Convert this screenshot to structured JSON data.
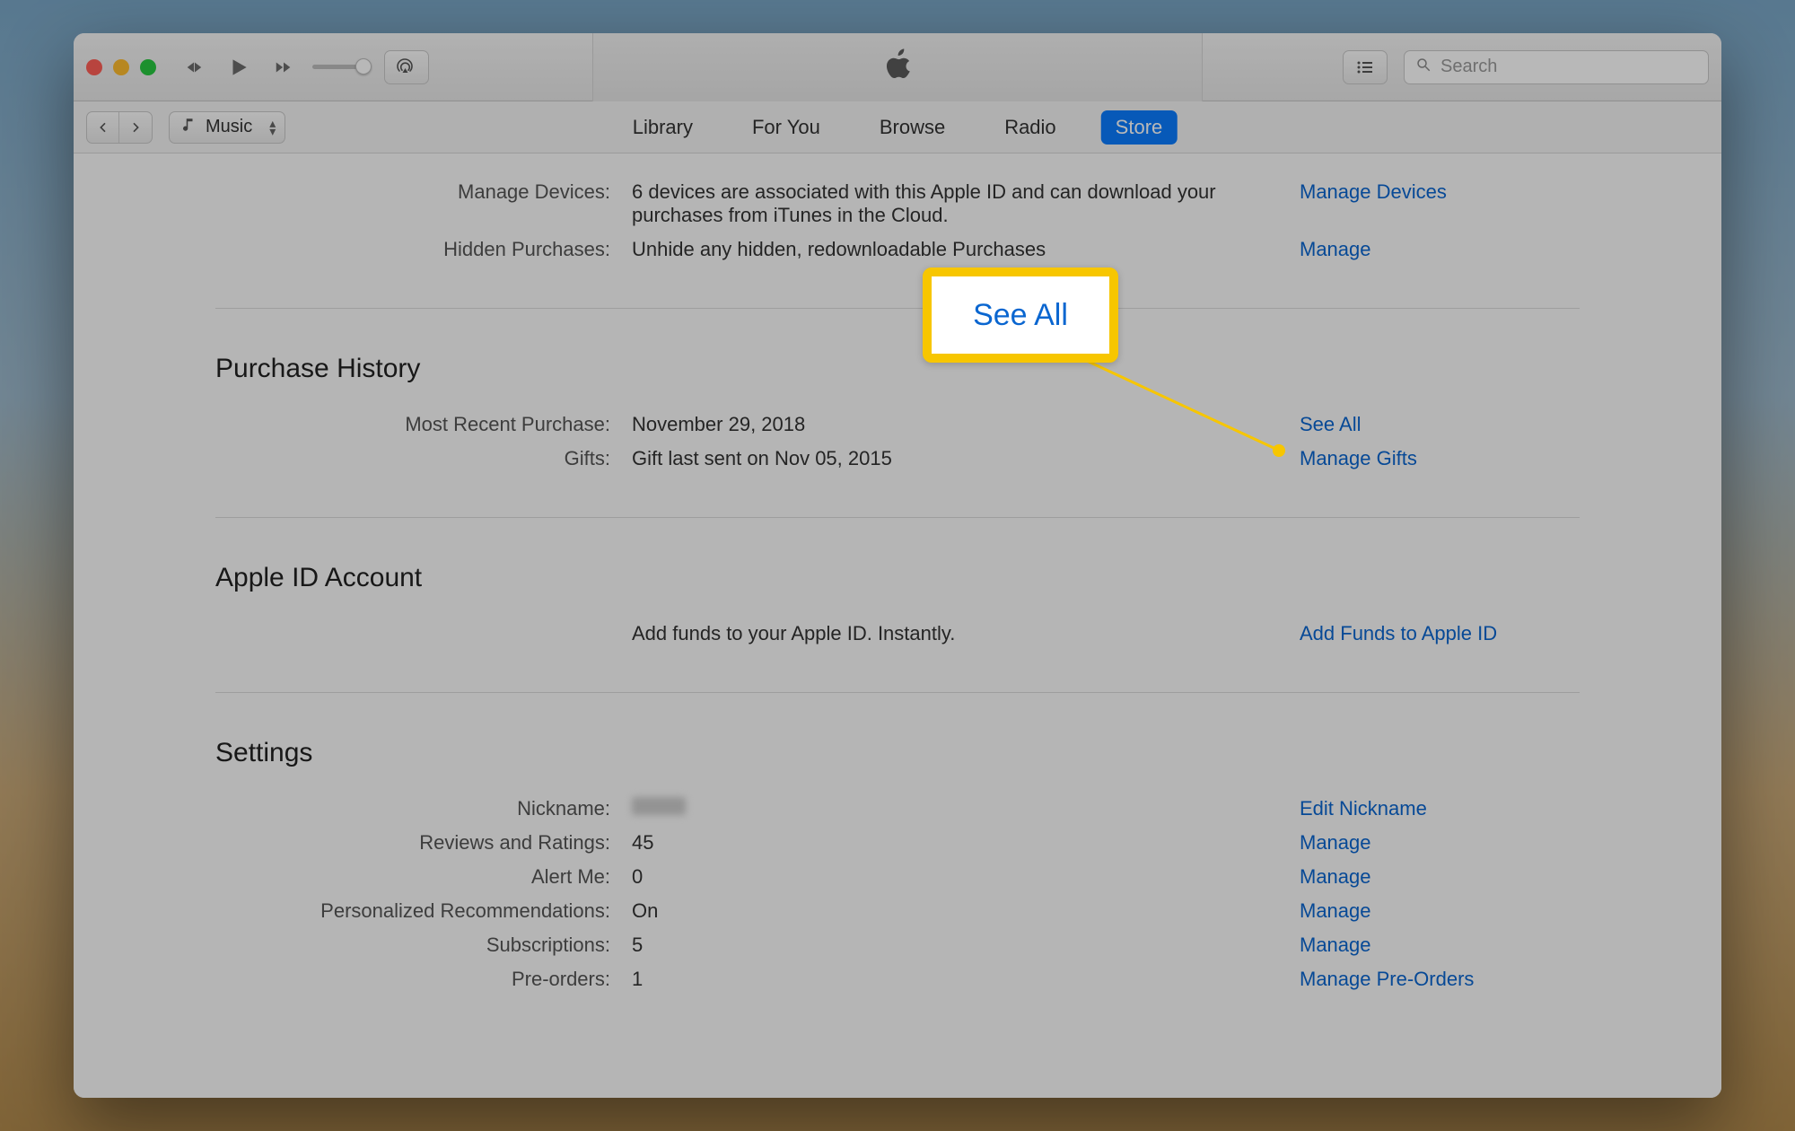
{
  "colors": {
    "accent": "#0a7cff",
    "link": "#0a66d0",
    "highlight": "#f7c600"
  },
  "titlebar": {
    "search_placeholder": "Search"
  },
  "nav": {
    "source_label": "Music",
    "tabs": {
      "library": "Library",
      "for_you": "For You",
      "browse": "Browse",
      "radio": "Radio",
      "store": "Store"
    },
    "active_tab": "store"
  },
  "callout": {
    "label": "See All"
  },
  "sections": {
    "cloud": {
      "rows": {
        "manage_devices": {
          "label": "Manage Devices:",
          "value": "6 devices are associated with this Apple ID and can download your purchases from iTunes in the Cloud.",
          "action": "Manage Devices"
        },
        "hidden_purchases": {
          "label": "Hidden Purchases:",
          "value": "Unhide any hidden, redownloadable Purchases",
          "action": "Manage"
        }
      }
    },
    "purchase_history": {
      "title": "Purchase History",
      "rows": {
        "recent": {
          "label": "Most Recent Purchase:",
          "value": "November 29, 2018",
          "action": "See All"
        },
        "gifts": {
          "label": "Gifts:",
          "value": "Gift last sent on Nov 05, 2015",
          "action": "Manage Gifts"
        }
      }
    },
    "apple_id": {
      "title": "Apple ID Account",
      "rows": {
        "funds": {
          "label": "",
          "value": "Add funds to your Apple ID. Instantly.",
          "action": "Add Funds to Apple ID"
        }
      }
    },
    "settings": {
      "title": "Settings",
      "rows": {
        "nickname": {
          "label": "Nickname:",
          "value": "",
          "action": "Edit Nickname"
        },
        "reviews": {
          "label": "Reviews and Ratings:",
          "value": "45",
          "action": "Manage"
        },
        "alert": {
          "label": "Alert Me:",
          "value": "0",
          "action": "Manage"
        },
        "recs": {
          "label": "Personalized Recommendations:",
          "value": "On",
          "action": "Manage"
        },
        "subs": {
          "label": "Subscriptions:",
          "value": "5",
          "action": "Manage"
        },
        "preorders": {
          "label": "Pre-orders:",
          "value": "1",
          "action": "Manage Pre-Orders"
        }
      }
    }
  }
}
